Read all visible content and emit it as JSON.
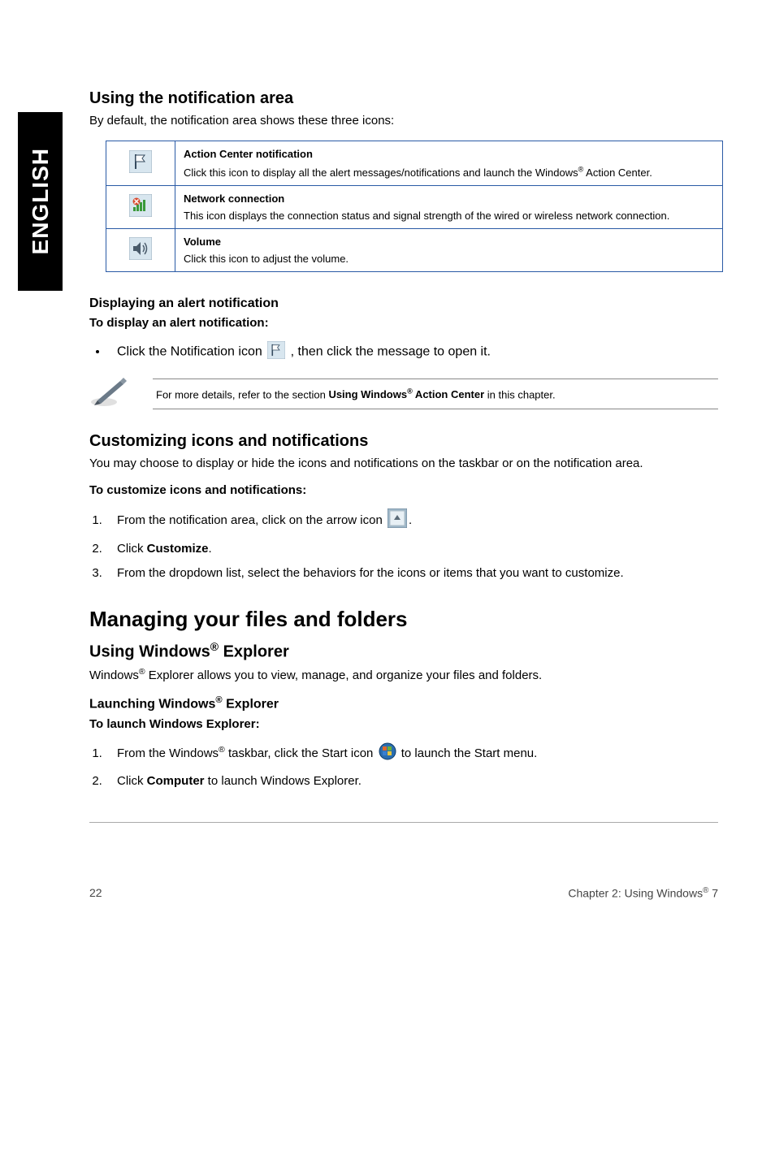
{
  "side_tab": "ENGLISH",
  "notif_area": {
    "heading": "Using the notification area",
    "intro": "By default, the notification area shows these three icons:",
    "rows": [
      {
        "title": "Action Center notification",
        "desc_pre": "Click this icon to display all the alert messages/notifications and launch the Windows",
        "desc_post": " Action Center."
      },
      {
        "title": "Network connection",
        "desc": "This icon displays the connection status and signal strength of the wired or wireless network connection."
      },
      {
        "title": "Volume",
        "desc": "Click this icon to adjust the volume."
      }
    ]
  },
  "display_alert": {
    "heading": "Displaying an alert notification",
    "sub": "To display an alert notification:",
    "step_pre": "Click the Notification icon ",
    "step_post": ", then click the message to open it.",
    "note_pre": "For more details, refer to the section ",
    "note_bold_pre": "Using Windows",
    "note_bold_post": " Action Center",
    "note_after": " in this chapter."
  },
  "customize": {
    "heading": "Customizing icons and notifications",
    "intro": "You may choose to display or hide the icons and notifications on the taskbar or on the notification area.",
    "sub": "To customize icons and notifications:",
    "step1_pre": "From the notification area, click on the arrow icon ",
    "step1_post": ".",
    "step2_pre": "Click ",
    "step2_bold": "Customize",
    "step2_post": ".",
    "step3": "From the dropdown list, select the behaviors for the icons or items that you want to customize."
  },
  "managing": {
    "heading": "Managing your files and folders",
    "explorer_heading_pre": "Using Windows",
    "explorer_heading_post": " Explorer",
    "explorer_intro_pre": "Windows",
    "explorer_intro_post": " Explorer allows you to view, manage, and organize your files and folders.",
    "launch_heading_pre": "Launching Windows",
    "launch_heading_post": " Explorer",
    "launch_sub": "To launch Windows Explorer:",
    "step1_pre": "From the Windows",
    "step1_mid": " taskbar, click the Start icon ",
    "step1_post": " to launch the Start menu.",
    "step2_pre": "Click ",
    "step2_bold": "Computer",
    "step2_post": " to launch Windows Explorer."
  },
  "footer": {
    "page": "22",
    "chapter_pre": "Chapter 2: Using Windows",
    "chapter_post": " 7"
  }
}
